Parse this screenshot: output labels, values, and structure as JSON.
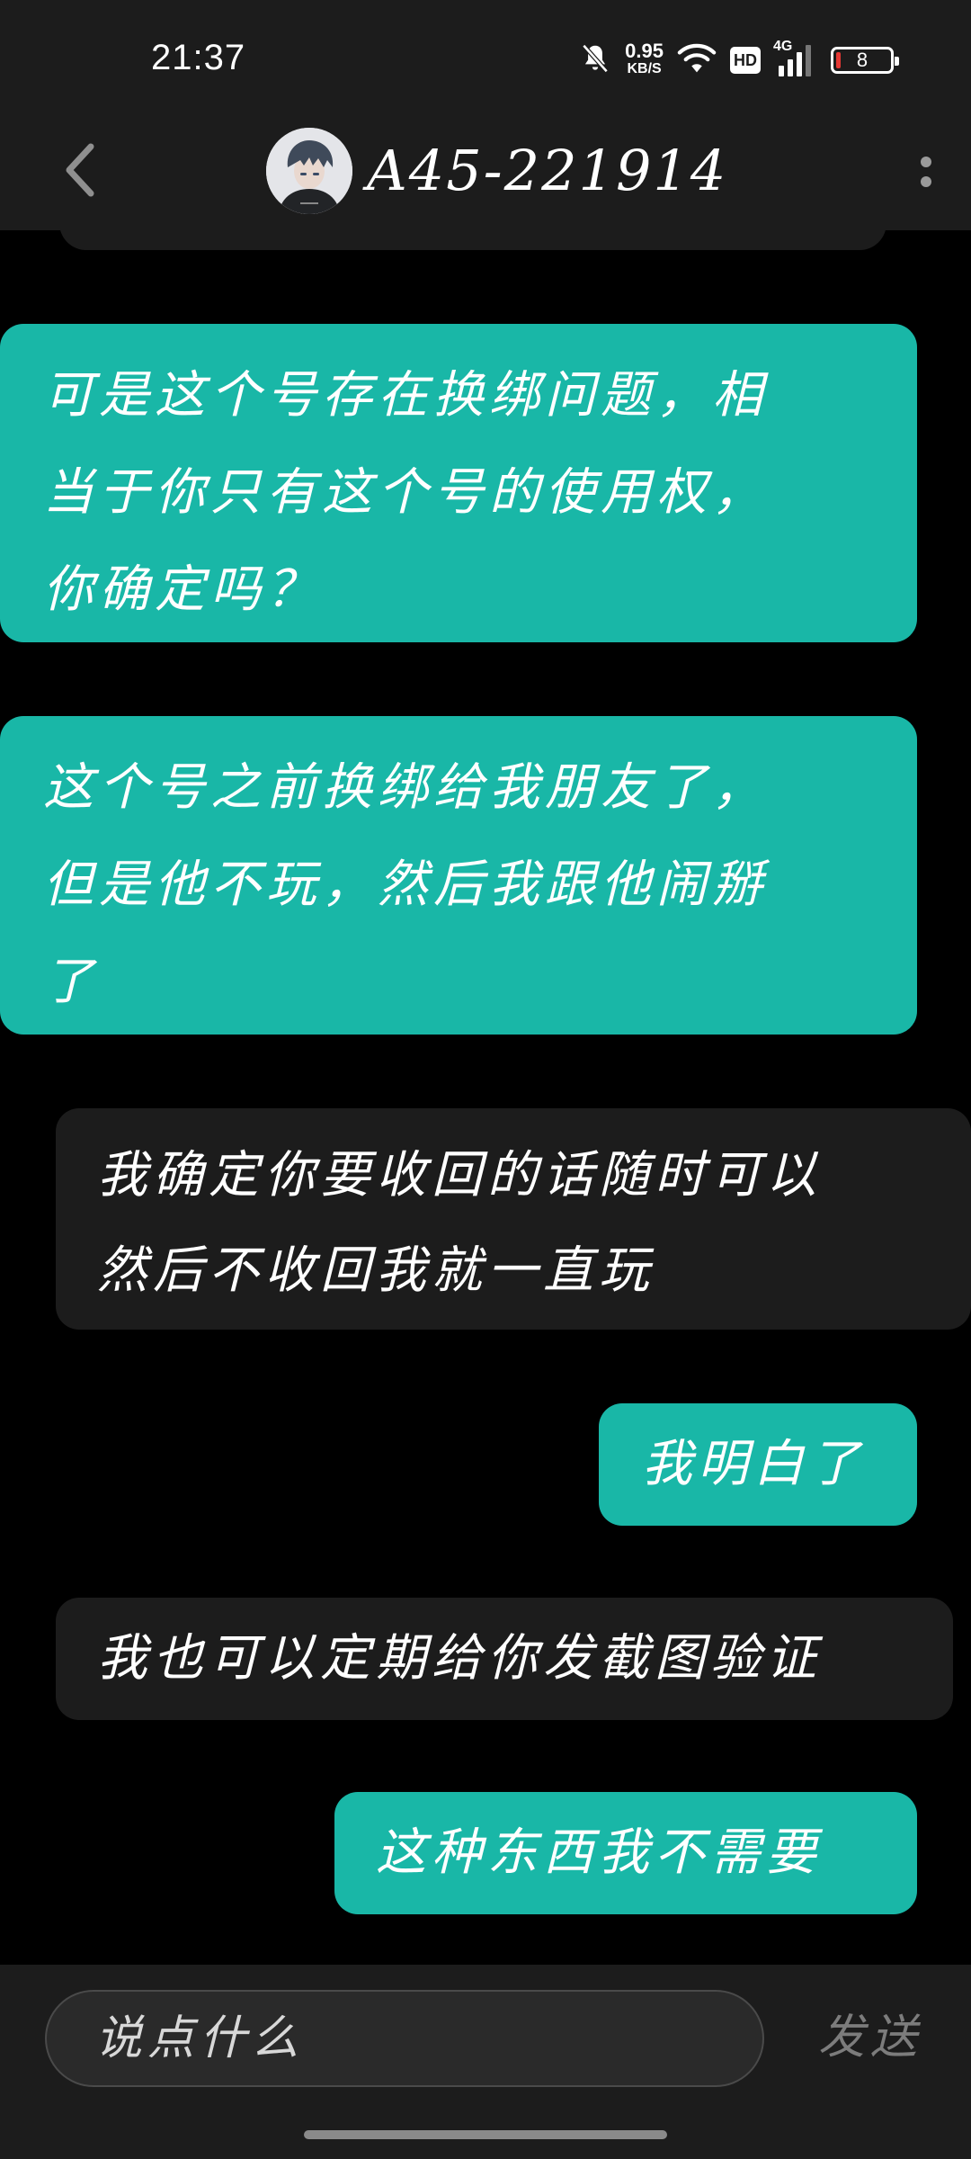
{
  "status_bar": {
    "time": "21:37",
    "net_speed_value": "0.95",
    "net_speed_unit": "KB/S",
    "hd_label": "HD",
    "signal_label": "4G",
    "battery_level": "8",
    "icons": [
      "bell-muted-icon",
      "wifi-icon",
      "hd-icon",
      "signal-icon",
      "battery-icon"
    ]
  },
  "header": {
    "contact_name": "A45-221914",
    "back_icon": "chevron-left-icon",
    "more_icon": "more-vertical-icon"
  },
  "messages": [
    {
      "side": "sent",
      "text": "可是这个号存在换绑问题，相\n当于你只有这个号的使用权，\n你确定吗？"
    },
    {
      "side": "sent",
      "text": "这个号之前换绑给我朋友了，\n但是他不玩，然后我跟他闹掰\n了"
    },
    {
      "side": "received",
      "text": "我确定你要收回的话随时可以\n然后不收回我就一直玩"
    },
    {
      "side": "sent",
      "text": "我明白了"
    },
    {
      "side": "received",
      "text": "我也可以定期给你发截图验证"
    },
    {
      "side": "sent",
      "text": "这种东西我不需要"
    }
  ],
  "input": {
    "placeholder": "说点什么",
    "send_label": "发送"
  },
  "colors": {
    "sent_bubble": "#19b7a7",
    "received_bubble": "#1c1c1c",
    "background": "#000000",
    "bar": "#1c1c1c",
    "send_disabled": "#7c7c7c"
  }
}
